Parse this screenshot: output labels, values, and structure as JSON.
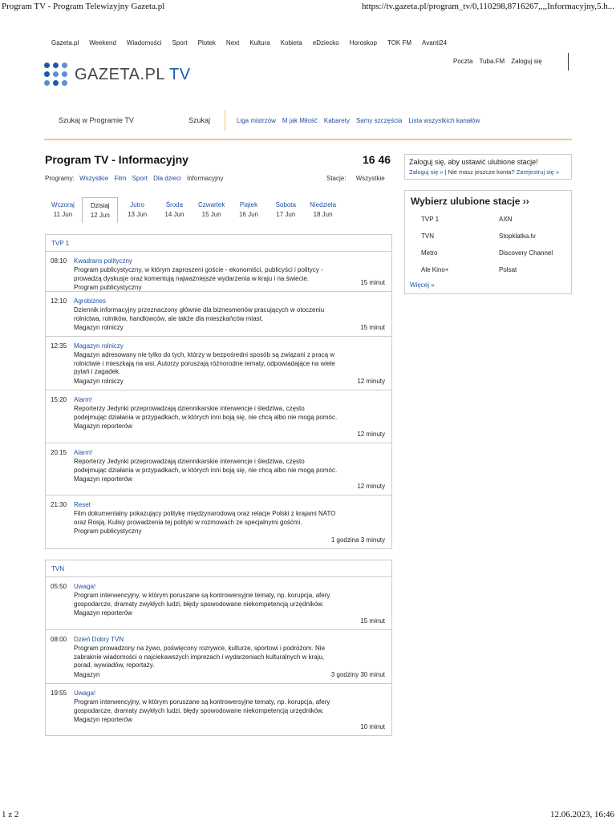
{
  "print": {
    "title": "Program TV - Program Telewizyjny Gazeta.pl",
    "url": "https://tv.gazeta.pl/program_tv/0,110298,8716267,,,,Informacyjny,5.h...",
    "page": "1 z 2",
    "datetime": "12.06.2023, 16:46"
  },
  "topnav": [
    "Gazeta.pl",
    "Weekend",
    "Wiadomości",
    "Sport",
    "Plotek",
    "Next",
    "Kultura",
    "Kobieta",
    "eDziecko",
    "Horoskop",
    "TOK FM",
    "Avanti24"
  ],
  "logo": {
    "main": "GAZETA.PL",
    "accent": "TV"
  },
  "user_links": [
    "Poczta",
    "Tuba.FM",
    "Zaloguj się"
  ],
  "search": {
    "placeholder": "Szukaj w Programie TV",
    "button": "Szukaj"
  },
  "quick_links": [
    "Liga mistrzów",
    "M jak Miłość",
    "Kabarety",
    "Samy szczęścia",
    "Lista wszystkich kanałów"
  ],
  "page_title": "Program TV - Informacyjny",
  "clock": "16 46",
  "filters": {
    "programs_label": "Programy:",
    "programs": [
      "Wszystkie",
      "Film",
      "Sport",
      "Dla dzieci"
    ],
    "active": "Informacyjny",
    "stations_label": "Stacje:",
    "stations_value": "Wszystkie"
  },
  "days": [
    {
      "name": "Wczoraj",
      "date": "11 Jun"
    },
    {
      "name": "Dzisiaj",
      "date": "12 Jun"
    },
    {
      "name": "Jutro",
      "date": "13 Jun"
    },
    {
      "name": "Środa",
      "date": "14 Jun"
    },
    {
      "name": "Czwartek",
      "date": "15 Jun"
    },
    {
      "name": "Piątek",
      "date": "16 Jun"
    },
    {
      "name": "Sobota",
      "date": "17 Jun"
    },
    {
      "name": "Niedziela",
      "date": "18 Jun"
    }
  ],
  "channels": [
    {
      "name": "TVP 1",
      "programs": [
        {
          "time": "08:10",
          "title": "Kwadrans polityczny",
          "desc": "Program publicystyczny, w którym zaproszeni goście - ekonomiści, publicyści i politycy - prowadzą dyskusje oraz komentują najważniejsze wydarzenia w kraju i na świecie.",
          "genre": "Program publicystyczny",
          "duration": "15 minut"
        },
        {
          "time": "12:10",
          "title": "Agrobiznes",
          "desc": "Dziennik informacyjny przeznaczony głównie dla biznesmenów pracujących w otoczeniu rolnictwa, rolników, handlowców, ale także dla mieszkańców miast.",
          "genre": "Magazyn rolniczy",
          "duration": "15 minut"
        },
        {
          "time": "12:35",
          "title": "Magazyn rolniczy",
          "desc": "Magazyn adresowany nie tylko do tych, którzy w bezpośredni sposób są związani z pracą w rolnictwie i mieszkają na wsi. Autorzy poruszają różnorodne tematy, odpowiadające na wiele pytań i zagadek.",
          "genre": "Magazyn rolniczy",
          "duration": "12 minuty"
        },
        {
          "time": "15:20",
          "title": "Alarm!",
          "desc": "Reporterzy Jedynki przeprowadzają dziennikarskie interwencje i śledztwa, często podejmując działania w przypadkach, w których inni boją się, nie chcą albo nie mogą pomóc.",
          "genre": "Magazyn reporterów",
          "duration": "12 minuty"
        },
        {
          "time": "20:15",
          "title": "Alarm!",
          "desc": "Reporterzy Jedynki przeprowadzają dziennikarskie interwencje i śledztwa, często podejmując działania w przypadkach, w których inni boją się, nie chcą albo nie mogą pomóc.",
          "genre": "Magazyn reporterów",
          "duration": "12 minuty"
        },
        {
          "time": "21:30",
          "title": "Reset",
          "desc": "Film dokumentalny pokazujący politykę międzynarodową oraz relacje Polski z krajami NATO oraz Rosją. Kulisy prowadzenia tej polityki w rozmowach ze specjalnymi gośćmi.",
          "genre": "Program publicystyczny",
          "duration": "1 godzina 3 minuty"
        }
      ]
    },
    {
      "name": "TVN",
      "programs": [
        {
          "time": "05:50",
          "title": "Uwaga!",
          "desc": "Program interwencyjny, w którym poruszane są kontrowersyjne tematy, np. korupcja, afery gospodarcze, dramaty zwykłych ludzi, błędy spowodowane niekompetencją urzędników.",
          "genre": "Magazyn reporterów",
          "duration": "15 minut"
        },
        {
          "time": "08:00",
          "title": "Dzień Dobry TVN",
          "desc": "Program prowadzony na żywo, poświęcony rozrywce, kulturze, sportowi i podróżom. Nie zabraknie wiadomości o najciekawszych imprezach i wydarzeniach kulturalnych w kraju, porad, wywiadów, reportaży.",
          "genre": "Magazyn",
          "duration": "3 godziny 30 minut"
        },
        {
          "time": "19:55",
          "title": "Uwaga!",
          "desc": "Program interwencyjny, w którym poruszane są kontrowersyjne tematy, np. korupcja, afery gospodarcze, dramaty zwykłych ludzi, błędy spowodowane niekompetencją urzędników.",
          "genre": "Magazyn reporterów",
          "duration": "10 minut"
        }
      ]
    }
  ],
  "login_box": {
    "text": "Zaloguj się, aby ustawić ulubione stacje!",
    "login_link": "Zaloguj się »",
    "no_account": "Nie masz jeszcze konta?",
    "register_link": "Zarejestruj się »"
  },
  "favorites": {
    "title": "Wybierz ulubione stacje ››",
    "stations": [
      "TVP 1",
      "AXN",
      "TVN",
      "Stopklatka.tv",
      "Metro",
      "Discovery Channel",
      "Ale Kino+",
      "Polsat"
    ],
    "more": "Więcej »"
  },
  "colors": {
    "link": "#1f4f9c",
    "logo_blue": "#1f5aa6",
    "accent_border": "#e8c98a"
  }
}
